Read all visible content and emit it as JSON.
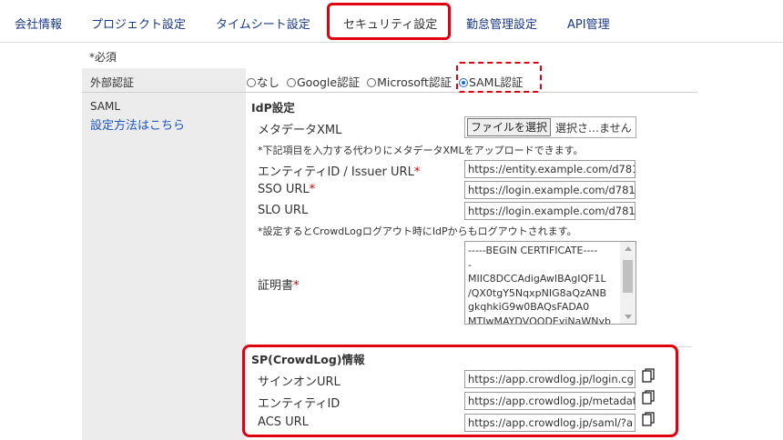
{
  "tabs": [
    {
      "label": "会社情報"
    },
    {
      "label": "プロジェクト設定"
    },
    {
      "label": "タイムシート設定"
    },
    {
      "label": "セキュリティ設定",
      "active": true
    },
    {
      "label": "勤怠管理設定"
    },
    {
      "label": "API管理"
    }
  ],
  "required_note": "*必須",
  "external_auth": {
    "label": "外部認証",
    "options": [
      "なし",
      "Google認証",
      "Microsoft認証",
      "SAML認証"
    ],
    "selected": "SAML認証"
  },
  "saml": {
    "label": "SAML",
    "link": "設定方法はこちら"
  },
  "idp": {
    "title": "IdP設定",
    "metadata_label": "メタデータXML",
    "file_button": "ファイルを選択",
    "file_status": "選択さ…ません",
    "metadata_note": "*下記項目を入力する代わりにメタデータXMLをアップロードできます。",
    "entity_label": "エンティティID / Issuer URL",
    "entity_value": "https://entity.example.com/d781",
    "sso_label": "SSO URL",
    "sso_value": "https://login.example.com/d781",
    "slo_label": "SLO URL",
    "slo_value": "https://login.example.com/d781",
    "slo_note": "*設定するとCrowdLogログアウト時にIdPからもログアウトされます。",
    "cert_label": "証明書",
    "cert_value": "-----BEGIN CERTIFICATE----\n-\nMIIC8DCCAdigAwIBAgIQF1L\n/QX0tgY5NqxpNIG8aQzANB\ngkqhkiG9w0BAQsFADA0\nMTIwMAYDVQQDEyiNaWNyb"
  },
  "required_mark": "*",
  "sp": {
    "title": "SP(CrowdLog)情報",
    "signon_label": "サインオンURL",
    "signon_value": "https://app.crowdlog.jp/login.cgi",
    "entity_label": "エンティティID",
    "entity_value": "https://app.crowdlog.jp/metadat",
    "acs_label": "ACS URL",
    "acs_value": "https://app.crowdlog.jp/saml/?a"
  },
  "colors": {
    "highlight": "#e0000f",
    "link": "#1a55c8",
    "tab_link": "#1a3a8a"
  }
}
